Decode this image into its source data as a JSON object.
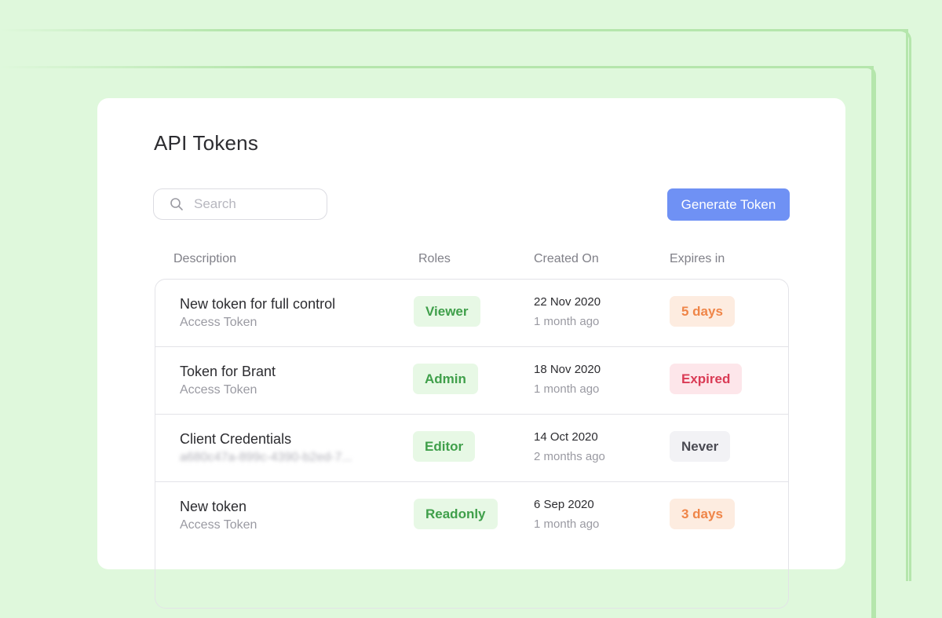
{
  "page": {
    "title": "API Tokens",
    "search_placeholder": "Search",
    "generate_button": "Generate Token"
  },
  "columns": {
    "description": "Description",
    "roles": "Roles",
    "created_on": "Created On",
    "expires_in": "Expires in"
  },
  "rows": [
    {
      "name": "New token for full control",
      "sub": "Access Token",
      "role": "Viewer",
      "date": "22 Nov 2020",
      "ago": "1 month ago",
      "expires": "5 days",
      "status": "warn"
    },
    {
      "name": "Token for Brant",
      "sub": "Access Token",
      "role": "Admin",
      "date": "18 Nov 2020",
      "ago": "1 month ago",
      "expires": "Expired",
      "status": "bad"
    },
    {
      "name": "Client Credentials",
      "sub": "a680c47a-899c-4390-b2ed-7...",
      "role": "Editor",
      "date": "14 Oct 2020",
      "ago": "2 months ago",
      "expires": "Never",
      "status": "neutral"
    },
    {
      "name": "New token",
      "sub": "Access Token",
      "role": "Readonly",
      "date": "6 Sep 2020",
      "ago": "1 month ago",
      "expires": "3 days",
      "status": "warn"
    }
  ],
  "colors": {
    "background": "#dff8dc",
    "accent": "#6f91f4",
    "role_badge": "#e7f8e5",
    "expires_warn": "#ef8548",
    "expires_bad": "#da3b55"
  },
  "icons": {
    "search": "search-icon"
  }
}
